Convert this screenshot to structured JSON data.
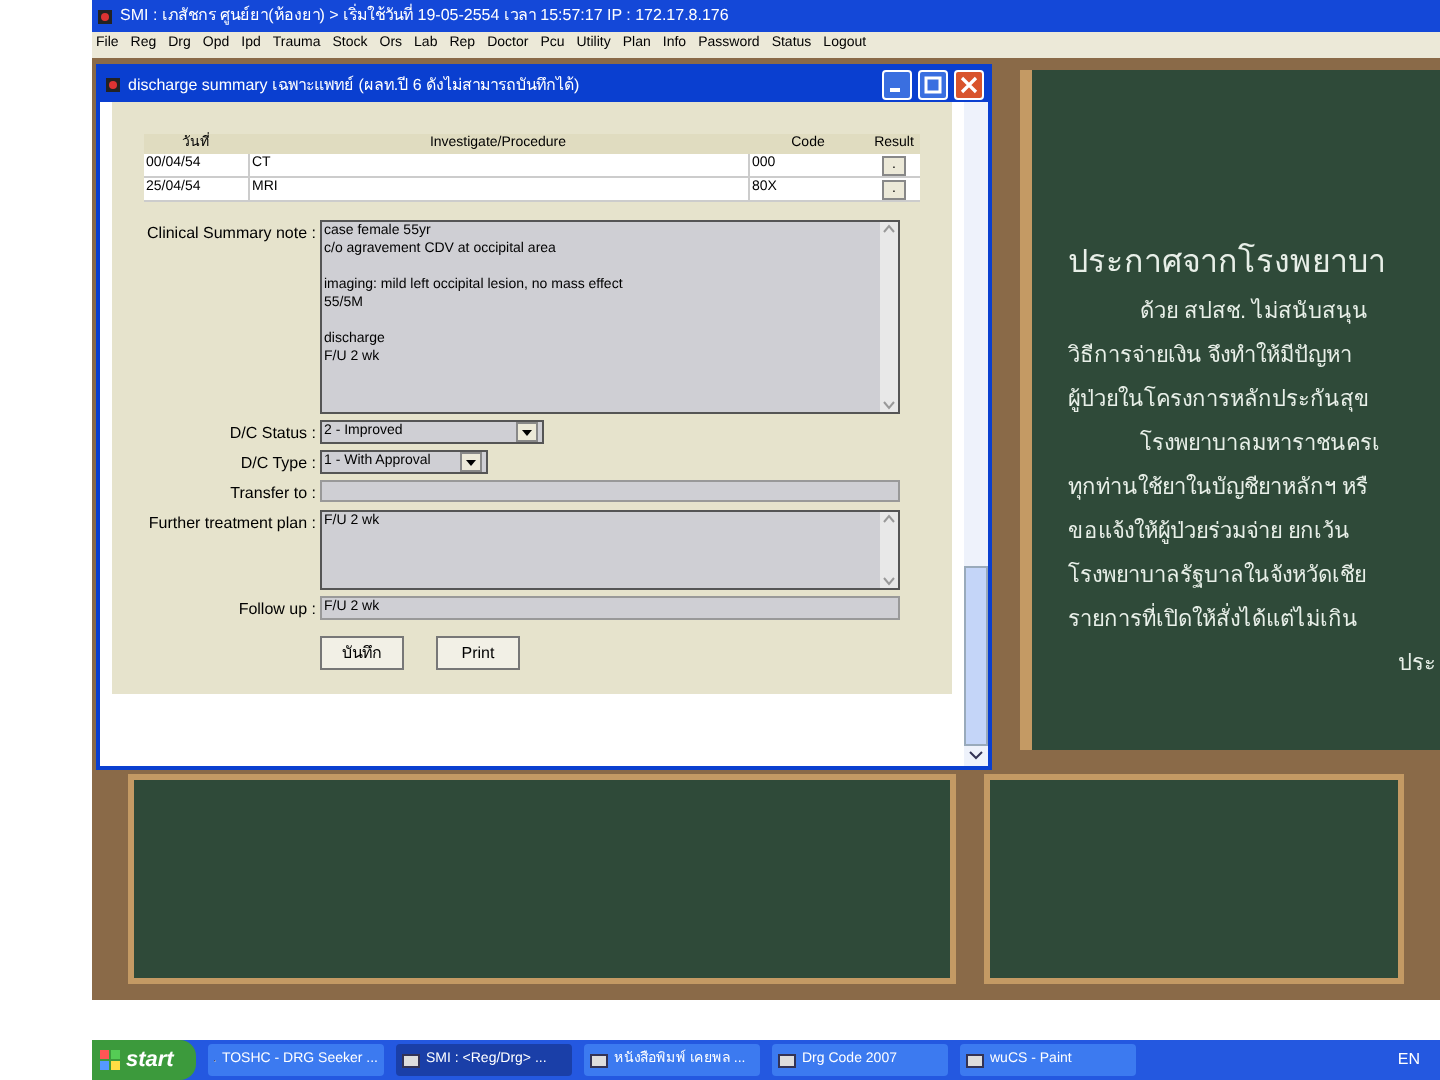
{
  "app_window": {
    "title": "SMI : เภสัชกร ศูนย์ยา(ห้องยา) > เริ่มใช้วันที่ 19-05-2554 เวลา 15:57:17 IP : 172.17.8.176",
    "menu": [
      "File",
      "Reg",
      "Drg",
      "Opd",
      "Ipd",
      "Trauma",
      "Stock",
      "Ors",
      "Lab",
      "Rep",
      "Doctor",
      "Pcu",
      "Utility",
      "Plan",
      "Info",
      "Password",
      "Status",
      "Logout"
    ]
  },
  "dialog": {
    "title": "discharge summary เฉพาะแพทย์ (ผลท.ปี 6 ดังไม่สามารถบันทึกได้)",
    "table": {
      "columns": [
        "วันที่",
        "Investigate/Procedure",
        "Code",
        "Result"
      ],
      "rows": [
        {
          "date": "00/04/54",
          "procedure": "CT",
          "code": "000",
          "result": "."
        },
        {
          "date": "25/04/54",
          "procedure": "MRI",
          "code": "80X",
          "result": "."
        }
      ]
    },
    "clinical_summary": {
      "label": "Clinical Summary note :",
      "paragraphs": [
        [
          "case female 55yr",
          "c/o agravement CDV at occipital area"
        ],
        [
          "imaging: mild left occipital lesion, no mass effect",
          "55/5M"
        ],
        [
          "discharge",
          "F/U 2 wk"
        ]
      ]
    },
    "dc_status": {
      "label": "D/C Status :",
      "value": "2 - Improved"
    },
    "dc_type": {
      "label": "D/C Type :",
      "value": "1 - With Approval"
    },
    "transfer_to": {
      "label": "Transfer to :"
    },
    "further_plan": {
      "label": "Further treatment plan :",
      "value": "F/U 2 wk"
    },
    "follow_up": {
      "label": "Follow up :",
      "value": "F/U 2 wk"
    },
    "buttons": [
      "บันทึก",
      "Print"
    ]
  },
  "board": {
    "heading": "ประกาศจากโรงพยาบา",
    "lines": [
      {
        "text": "ด้วย สปสช. ไม่สนับสนุน",
        "indent": true
      },
      {
        "text": "วิธีการจ่ายเงิน จึงทำให้มีปัญหา",
        "indent": false
      },
      {
        "text": "ผู้ป่วยในโครงการหลักประกันสุข",
        "indent": false
      },
      {
        "text": "โรงพยาบาลมหาราชนครเ",
        "indent": true
      },
      {
        "text": "ทุกท่านใช้ยาในบัญชียาหลักฯ หรื",
        "indent": false
      },
      {
        "text": "ขอแจ้งให้ผู้ป่วยร่วมจ่าย ยกเว้น",
        "indent": false
      },
      {
        "text": "โรงพยาบาลรัฐบาลในจังหวัดเชีย",
        "indent": false
      },
      {
        "text": "รายการที่เปิดให้สั่งได้แต่ไม่เกิน",
        "indent": false
      }
    ],
    "signature": "ประ"
  },
  "taskbar": {
    "start": "start",
    "items": [
      {
        "label": "TOSHC - DRG Seeker ...",
        "selected": false
      },
      {
        "label": "SMI : <Reg/Drg> ...",
        "selected": true
      },
      {
        "label": "หนังสือพิมพ์ เคยพล ...",
        "selected": false
      },
      {
        "label": "Drg Code 2007",
        "selected": false
      },
      {
        "label": "wuCS - Paint",
        "selected": false
      }
    ],
    "language": "EN"
  }
}
